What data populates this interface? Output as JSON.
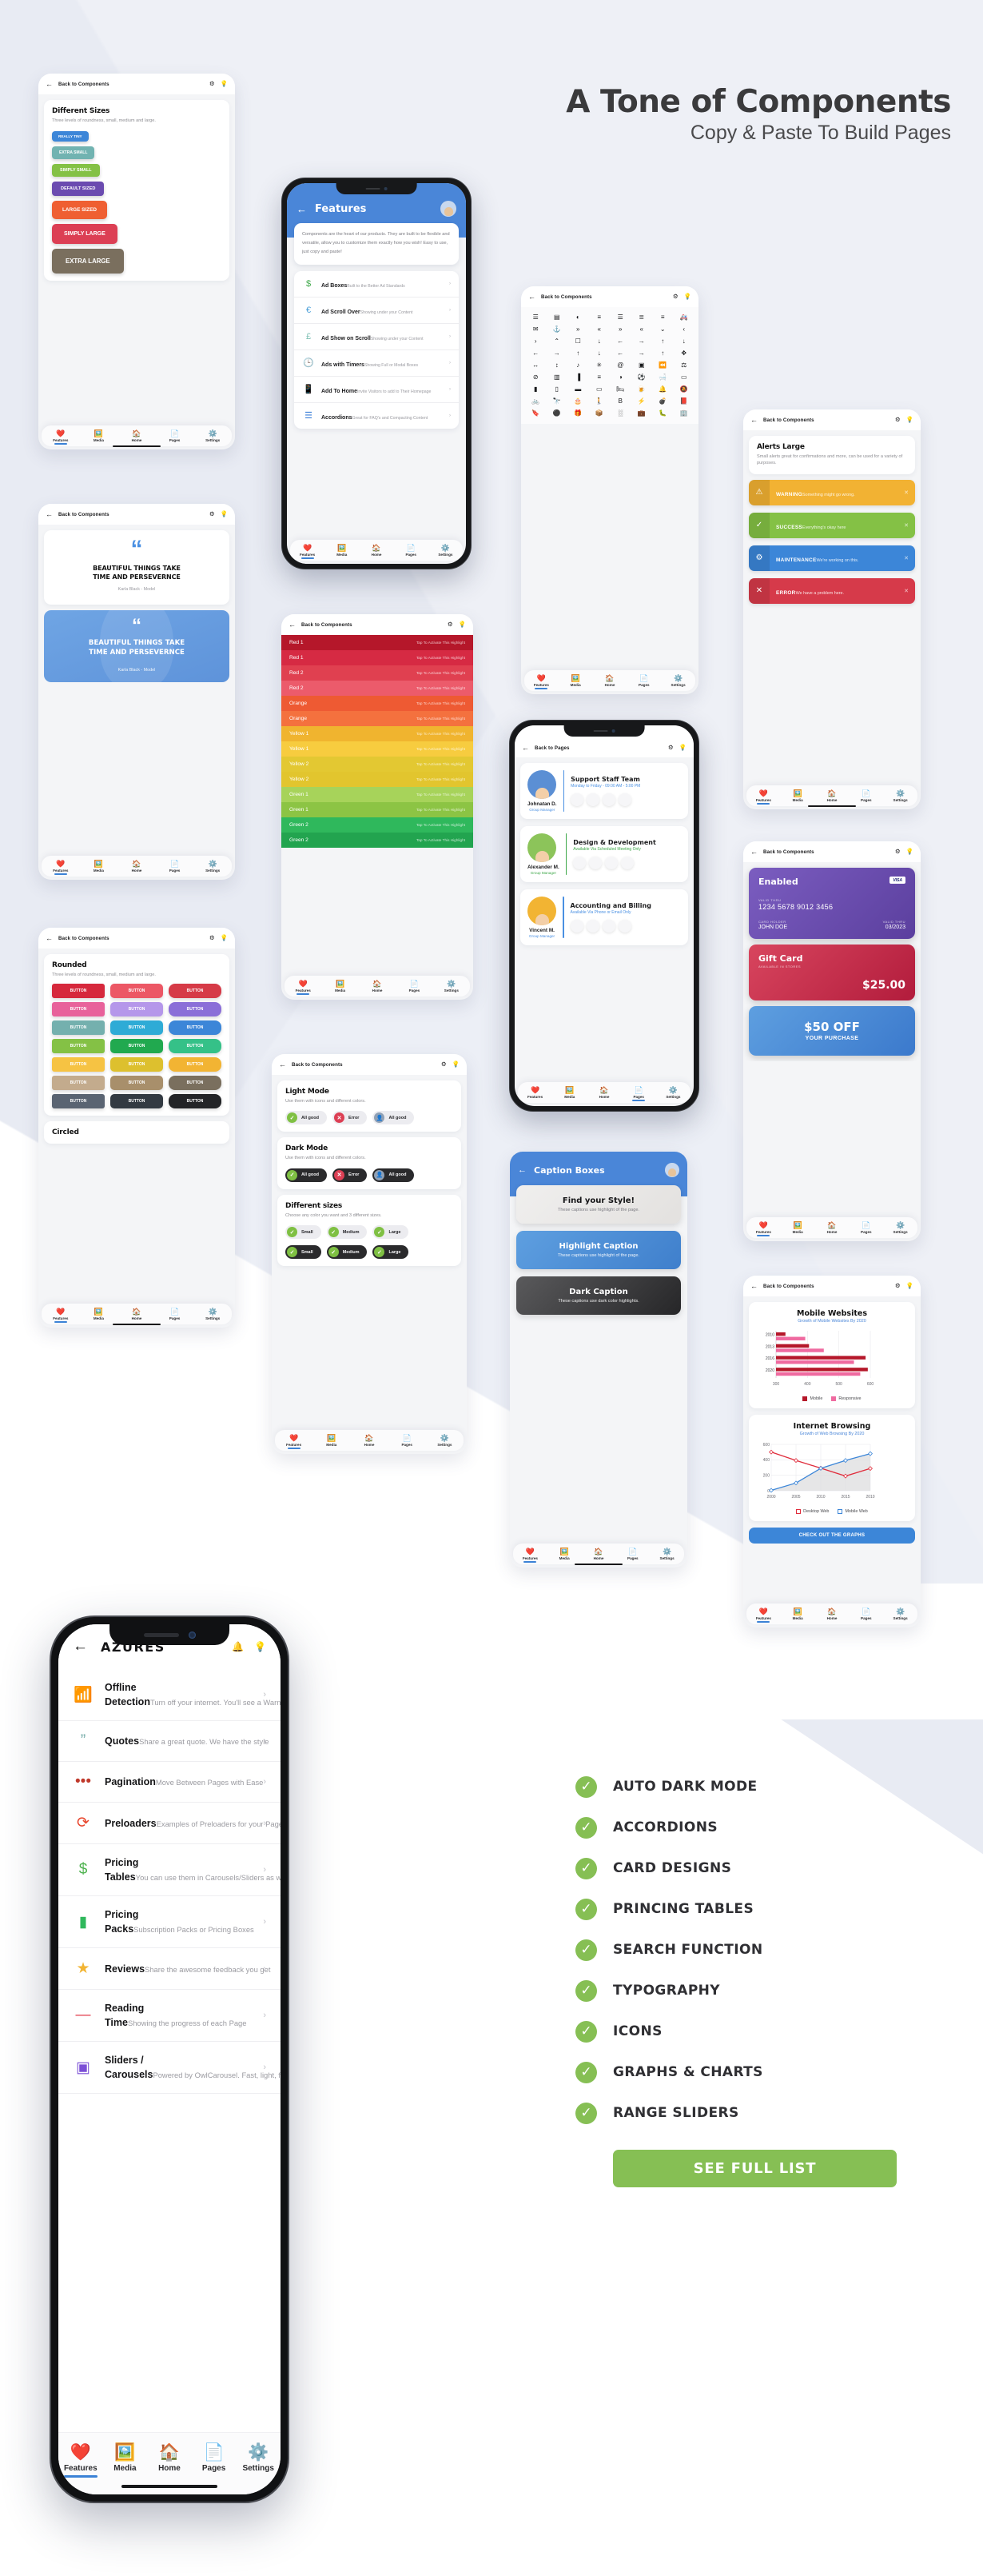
{
  "header": {
    "title": "A Tone of Components",
    "subtitle": "Copy & Paste To Build Pages"
  },
  "common": {
    "back_to_components": "Back to Components",
    "back_to_pages": "Back to Pages",
    "gear_icon": "gear-icon",
    "bulb_icon": "bulb-icon",
    "back_icon": "back-arrow-icon",
    "tabs": [
      {
        "label": "Features",
        "icon": "heart-icon",
        "glyph": "❤️"
      },
      {
        "label": "Media",
        "icon": "image-icon",
        "glyph": "🖼️"
      },
      {
        "label": "Home",
        "icon": "home-icon",
        "glyph": "🏠"
      },
      {
        "label": "Pages",
        "icon": "page-icon",
        "glyph": "📄"
      },
      {
        "label": "Settings",
        "icon": "gear-icon",
        "glyph": "⚙️"
      }
    ]
  },
  "card_sizes": {
    "title": "Different Sizes",
    "subtitle": "Three levels of roundness, small, medium and large.",
    "buttons": [
      {
        "label": "REALLY TINY",
        "color": "#3c86d8",
        "font": 4.6,
        "pad": "4px 8px",
        "radius": "4px"
      },
      {
        "label": "EXTRA SMALL",
        "color": "#71b3b1",
        "font": 5.0,
        "pad": "5px 9px",
        "radius": "4px"
      },
      {
        "label": "SIMPLY SMALL",
        "color": "#84c145",
        "font": 5.4,
        "pad": "5px 10px",
        "radius": "4px"
      },
      {
        "label": "DEFAULT SIZED",
        "color": "#6b4bb0",
        "font": 5.6,
        "pad": "6px 11px",
        "radius": "4px"
      },
      {
        "label": "LARGE SIZED",
        "color": "#ef5f32",
        "font": 6.4,
        "pad": "8px 13px",
        "radius": "5px"
      },
      {
        "label": "SIMPLY LARGE",
        "color": "#dc3f54",
        "font": 7.0,
        "pad": "9px 15px",
        "radius": "5px"
      },
      {
        "label": "EXTRA LARGE",
        "color": "#7a6f5e",
        "font": 7.8,
        "pad": "11px 17px",
        "radius": "5px"
      }
    ]
  },
  "card_quote": {
    "quote_glyph": "“",
    "quote_line1": "BEAUTIFUL THINGS TAKE",
    "quote_line2": "TIME AND PERSEVERNCE",
    "author": "Karla Black - Model",
    "accent": "#4a90e2"
  },
  "card_rounded": {
    "title": "Rounded",
    "subtitle": "Three levels of roundness, small, medium and large.",
    "button_label": "BUTTON",
    "second_title": "Circled",
    "rows": [
      {
        "colors": [
          "#d6283c",
          "#ec5765",
          "#d63a47"
        ],
        "radii": [
          "3px",
          "5px",
          "8px"
        ]
      },
      {
        "colors": [
          "#e8629b",
          "#b597ea",
          "#8b6fd8"
        ],
        "radii": [
          "3px",
          "5px",
          "8px"
        ]
      },
      {
        "colors": [
          "#74b0ae",
          "#2eabd6",
          "#3c86d8"
        ],
        "radii": [
          "3px",
          "5px",
          "8px"
        ]
      },
      {
        "colors": [
          "#84c145",
          "#21a94f",
          "#35c188"
        ],
        "radii": [
          "3px",
          "5px",
          "8px"
        ]
      },
      {
        "colors": [
          "#f6c343",
          "#ddc02e",
          "#f2b433"
        ],
        "radii": [
          "3px",
          "5px",
          "8px"
        ]
      },
      {
        "colors": [
          "#c3ab8d",
          "#a88f6b",
          "#7a6f5e"
        ],
        "radii": [
          "3px",
          "5px",
          "8px"
        ]
      },
      {
        "colors": [
          "#5a6472",
          "#333a42",
          "#232427"
        ],
        "radii": [
          "3px",
          "5px",
          "8px"
        ]
      }
    ]
  },
  "phone_features": {
    "title": "Features",
    "intro": "Components are the heart of our products. They are built to be flexible and versatile, allow you to customize them exactly how you wish! Easy to use, just copy and paste!",
    "avatar_icon": "user-avatar-icon",
    "rows": [
      {
        "icon": "dollar-icon",
        "glyph": "$",
        "color": "#3fa84a",
        "title": "Ad Boxes",
        "sub": "Built to the Better Ad Standards"
      },
      {
        "icon": "euro-icon",
        "glyph": "€",
        "color": "#4a9fd8",
        "title": "Ad Scroll Over",
        "sub": "Showing under your Content"
      },
      {
        "icon": "pound-icon",
        "glyph": "£",
        "color": "#7fc0b4",
        "title": "Ad Show on Scroll",
        "sub": "Showing under your Content"
      },
      {
        "icon": "clock-icon",
        "glyph": "🕒",
        "color": "#c98b3a",
        "title": "Ads with Timers",
        "sub": "Showing Full or Modal Boxes"
      },
      {
        "icon": "mobile-icon",
        "glyph": "📱",
        "color": "#9a9aa0",
        "title": "Add To Home",
        "sub": "Invite Visitors to add to Their Homepage"
      },
      {
        "icon": "list-icon",
        "glyph": "☰",
        "color": "#3c7fd8",
        "title": "Accordions",
        "sub": "Great for FAQ's and Compacting Content"
      }
    ]
  },
  "card_colors": {
    "tap_text": "Tap To Activate This Highlight",
    "rows": [
      {
        "label": "Red 1",
        "color": "#b5172a"
      },
      {
        "label": "Red 1",
        "color": "#d62a43"
      },
      {
        "label": "Red 2",
        "color": "#e04050"
      },
      {
        "label": "Red 2",
        "color": "#ec5b6b"
      },
      {
        "label": "Orange",
        "color": "#ee5a33"
      },
      {
        "label": "Orange",
        "color": "#f4713e"
      },
      {
        "label": "Yellow 1",
        "color": "#f0b42f"
      },
      {
        "label": "Yellow 1",
        "color": "#f7cc3f"
      },
      {
        "label": "Yellow 2",
        "color": "#e3c832"
      },
      {
        "label": "Yellow 2",
        "color": "#e2c52e"
      },
      {
        "label": "Green 1",
        "color": "#a7d35a"
      },
      {
        "label": "Green 1",
        "color": "#8cc444"
      },
      {
        "label": "Green 2",
        "color": "#2fb85c"
      },
      {
        "label": "Green 2",
        "color": "#22a44f"
      }
    ]
  },
  "card_modes": {
    "light": {
      "title": "Light Mode",
      "subtitle": "Use them with icons and different colors."
    },
    "dark": {
      "title": "Dark Mode",
      "subtitle": "Use them with icons and different colors."
    },
    "sizes": {
      "title": "Different sizes",
      "subtitle": "Choose any color you want and 3 different sizes."
    },
    "badges": [
      {
        "label": "All good",
        "icon": "check-icon",
        "glyph": "✓",
        "color": "#7fc043"
      },
      {
        "label": "Error",
        "icon": "cross-icon",
        "glyph": "✕",
        "color": "#dc3f54"
      },
      {
        "label": "All good",
        "icon": "avatar-icon",
        "glyph": "👤",
        "color": "#8fa0b5"
      }
    ],
    "size_badges": [
      {
        "label": "Small",
        "icon": "check-icon",
        "glyph": "✓",
        "color": "#7fc043"
      },
      {
        "label": "Medium",
        "icon": "check-icon",
        "glyph": "✓",
        "color": "#7fc043"
      },
      {
        "label": "Large",
        "icon": "check-icon",
        "glyph": "✓",
        "color": "#7fc043"
      }
    ]
  },
  "card_icons": {
    "glyphs": [
      "☰",
      "▤",
      "◐",
      "≡",
      "☰",
      "≣",
      "≡",
      "🚑",
      "✉",
      "⚓",
      "»",
      "«",
      "»",
      "«",
      "⌄",
      "‹",
      "›",
      "⌃",
      "☐",
      "↓",
      "←",
      "→",
      "↑",
      "↓",
      "←",
      "→",
      "↑",
      "↓",
      "←",
      "→",
      "↑",
      "✥",
      "↔",
      "↕",
      "♪",
      "✳",
      "@",
      "▣",
      "⏪",
      "⚖",
      "⊘",
      "▥",
      "▐",
      "≡",
      "◑",
      "⚽",
      "🛁",
      "▭",
      "▮",
      "▯",
      "▬",
      "▭",
      "🛏",
      "🍺",
      "🔔",
      "🔕",
      "🚲",
      "🔭",
      "🎂",
      "🚶",
      "B",
      "⚡",
      "💣",
      "📕",
      "🔖",
      "⚫",
      "🎁",
      "📦",
      "░",
      "💼",
      "🐛",
      "🏢"
    ]
  },
  "phone_pages": {
    "title": "Back to Pages",
    "teams": [
      {
        "name": "Johnatan D.",
        "role": "Group Manager",
        "title": "Support Staff Team",
        "sub": "Monday to Friday - 09:00 AM - 5:00 PM",
        "accent": "#4a90e2",
        "ring": "#4a86d8"
      },
      {
        "name": "Alexander M.",
        "role": "Group Manager",
        "title": "Design & Development",
        "sub": "Available Via Scheduled Meeting Only",
        "accent": "#3fa84a",
        "ring": "#8cc45a"
      },
      {
        "name": "Vincent M.",
        "role": "Group Manager",
        "title": "Accounting and Billing",
        "sub": "Available Via Phone or Email Only",
        "accent": "#4a90e2",
        "ring": "#f2b433"
      }
    ]
  },
  "phone_captions": {
    "title": "Caption Boxes",
    "boxes": [
      {
        "t": "Find your Style!",
        "s": "These captions use highlight of the page.",
        "style": "light"
      },
      {
        "t": "Highlight Caption",
        "s": "These captions use highlight of the page.",
        "style": "blue"
      },
      {
        "t": "Dark Caption",
        "s": "These captions use dark color highlights.",
        "style": "dark"
      }
    ]
  },
  "card_alerts": {
    "title": "Alerts Large",
    "subtitle": "Small alerts great for confirmations and more, can be used for a variety of purposes.",
    "items": [
      {
        "t": "WARNING",
        "s": "Something might go wrong.",
        "color": "#f2b233",
        "icon": "warning-icon",
        "glyph": "⚠"
      },
      {
        "t": "SUCCESS",
        "s": "Everything's okay here",
        "color": "#84c145",
        "icon": "check-icon",
        "glyph": "✓"
      },
      {
        "t": "MAINTENANCE",
        "s": "We're working on this.",
        "color": "#3c86d8",
        "icon": "gear-icon",
        "glyph": "⚙"
      },
      {
        "t": "ERROR",
        "s": "We have a problem here.",
        "color": "#d63a4a",
        "icon": "error-icon",
        "glyph": "✕"
      }
    ]
  },
  "card_cards": {
    "enabled": {
      "title": "Enabled",
      "brand": "VISA",
      "number_label": "VALID THRU",
      "number": "1234 5678 9012 3456",
      "holder_label": "CARD HOLDER",
      "holder": "JOHN DOE",
      "expiry_label": "VALID THRU",
      "expiry": "03/2023"
    },
    "gift": {
      "title": "Gift Card",
      "subtitle": "AVAILABLE IN STORES",
      "amount": "$25.00"
    },
    "offer": {
      "title": "$50 OFF",
      "subtitle": "YOUR PURCHASE"
    }
  },
  "card_charts": {
    "footer_button": "CHECK OUT THE GRAPHS",
    "chart_data": [
      {
        "type": "bar",
        "title": "Mobile Websites",
        "subtitle": "Growth of Mobile Websites By 2020",
        "orientation": "horizontal",
        "categories": [
          "2010",
          "2013",
          "2016",
          "2020"
        ],
        "series": [
          {
            "name": "Mobile",
            "color": "#b5172a",
            "values": [
              330,
              405,
              585,
              592
            ]
          },
          {
            "name": "Responsive",
            "color": "#ef6aa0",
            "values": [
              393,
              452,
              548,
              568
            ]
          }
        ],
        "xlabel": "",
        "ylabel": "",
        "xlim": [
          300,
          600
        ],
        "xticks": [
          300,
          400,
          500,
          600
        ],
        "grid": true,
        "legend_position": "bottom"
      },
      {
        "type": "line",
        "title": "Internet Browsing",
        "subtitle": "Growth of Web Browsing By 2020",
        "x": [
          "2000",
          "2005",
          "2010",
          "2015",
          "2010"
        ],
        "series": [
          {
            "name": "Desktop Web",
            "color": "#e02d3c",
            "values": [
              500,
              392,
              292,
              190,
              288
            ]
          },
          {
            "name": "Mobile Web",
            "color": "#3c86d8",
            "values": [
              5,
              100,
              290,
              392,
              480
            ]
          }
        ],
        "ylim": [
          0,
          600
        ],
        "yticks": [
          0,
          200,
          400,
          600
        ],
        "grid": true,
        "legend_position": "bottom"
      }
    ]
  },
  "bigphone": {
    "title": "AZURES",
    "back_icon": "back-arrow-icon",
    "right_icons": [
      "bell-icon",
      "bulb-icon"
    ],
    "rows": [
      {
        "icon": "wifi-icon",
        "glyph": "📶",
        "color": "#4fb350",
        "title": "Offline Detection",
        "sub": "Turn off your internet. You'll see a Warning"
      },
      {
        "icon": "quote-icon",
        "glyph": "”",
        "color": "#6fa8a5",
        "title": "Quotes",
        "sub": "Share a great quote. We have the style"
      },
      {
        "icon": "dots-icon",
        "glyph": "•••",
        "color": "#c0392b",
        "title": "Pagination",
        "sub": "Move Between Pages with Ease"
      },
      {
        "icon": "reload-icon",
        "glyph": "⟳",
        "color": "#e8452c",
        "title": "Preloaders",
        "sub": "Examples of Preloaders for your Pages"
      },
      {
        "icon": "dollar-icon",
        "glyph": "$",
        "color": "#4fb350",
        "title": "Pricing Tables",
        "sub": "You can use them in Carousels/Sliders as well"
      },
      {
        "icon": "wallet-icon",
        "glyph": "▮",
        "color": "#2fb85c",
        "title": "Pricing Packs",
        "sub": "Subscription Packs or Pricing Boxes"
      },
      {
        "icon": "star-icon",
        "glyph": "★",
        "color": "#f2b433",
        "title": "Reviews",
        "sub": "Share the awesome feedback you get"
      },
      {
        "icon": "minus-icon",
        "glyph": "—",
        "color": "#e03a4a",
        "title": "Reading Time",
        "sub": "Showing the progress of each Page"
      },
      {
        "icon": "image-icon",
        "glyph": "▣",
        "color": "#7b4fd6",
        "title": "Sliders / Carousels",
        "sub": "Powered by OwlCarousel. Fast, light, flexible."
      }
    ],
    "tabs": [
      {
        "label": "Features",
        "glyph": "❤️"
      },
      {
        "label": "Media",
        "glyph": "🖼️"
      },
      {
        "label": "Home",
        "glyph": "🏠"
      },
      {
        "label": "Pages",
        "glyph": "📄"
      },
      {
        "label": "Settings",
        "glyph": "⚙️"
      }
    ]
  },
  "checklist": {
    "check_icon": "check-circle-icon",
    "accent": "#86bf54",
    "items": [
      "AUTO DARK MODE",
      "ACCORDIONS",
      "CARD DESIGNS",
      "PRINCING TABLES",
      "SEARCH FUNCTION",
      "TYPOGRAPHY",
      "ICONS",
      "GRAPHS & CHARTS",
      "RANGE SLIDERS"
    ],
    "button_label": "SEE FULL LIST"
  }
}
